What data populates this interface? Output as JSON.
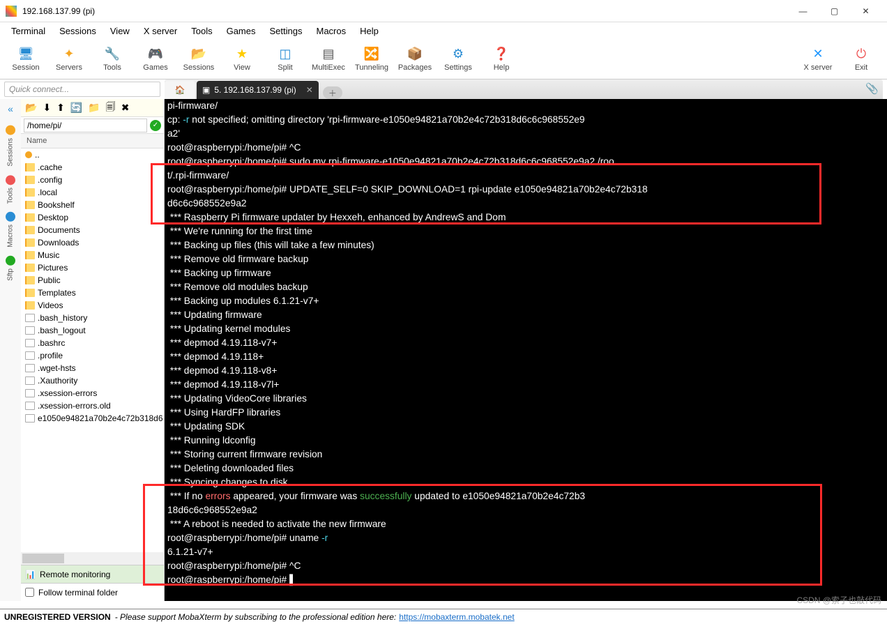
{
  "window": {
    "title": "192.168.137.99 (pi)"
  },
  "menu": [
    "Terminal",
    "Sessions",
    "View",
    "X server",
    "Tools",
    "Games",
    "Settings",
    "Macros",
    "Help"
  ],
  "toolbar": [
    {
      "label": "Session",
      "icon": "🖥",
      "cls": "ic-sess"
    },
    {
      "label": "Servers",
      "icon": "✦",
      "cls": "ic-serv"
    },
    {
      "label": "Tools",
      "icon": "🔧",
      "cls": "ic-tool"
    },
    {
      "label": "Games",
      "icon": "🎮",
      "cls": "ic-game"
    },
    {
      "label": "Sessions",
      "icon": "📂",
      "cls": "ic-sessn"
    },
    {
      "label": "View",
      "icon": "★",
      "cls": "ic-view"
    },
    {
      "label": "Split",
      "icon": "◫",
      "cls": "ic-split"
    },
    {
      "label": "MultiExec",
      "icon": "▤",
      "cls": "ic-multi"
    },
    {
      "label": "Tunneling",
      "icon": "🔀",
      "cls": "ic-tun"
    },
    {
      "label": "Packages",
      "icon": "📦",
      "cls": "ic-pkg"
    },
    {
      "label": "Settings",
      "icon": "⚙",
      "cls": "ic-set"
    },
    {
      "label": "Help",
      "icon": "❓",
      "cls": "ic-help"
    }
  ],
  "toolbar_right": [
    {
      "label": "X server",
      "icon": "✕",
      "cls": "ic-xs"
    },
    {
      "label": "Exit",
      "icon": "⏻",
      "cls": "ic-exit"
    }
  ],
  "quickconnect": {
    "placeholder": "Quick connect..."
  },
  "tabs": [
    {
      "label": "",
      "icon": "🏠",
      "type": "home"
    },
    {
      "label": "5. 192.168.137.99 (pi)",
      "icon": "▣",
      "type": "active",
      "closable": true
    },
    {
      "label": "",
      "icon": "＋",
      "type": "new"
    }
  ],
  "rail": [
    {
      "label": "Sessions",
      "color": "#f5a623"
    },
    {
      "label": "Tools",
      "color": "#e55"
    },
    {
      "label": "Macros",
      "color": "#2a8dd4"
    },
    {
      "label": "Sftp",
      "color": "#2a2"
    }
  ],
  "sftp": {
    "toolbar_icons": [
      "📂",
      "⬇",
      "⬆",
      "🔄",
      "📁",
      "🗐",
      "✖"
    ],
    "path": "/home/pi/",
    "header": "Name",
    "items": [
      {
        "name": "..",
        "type": "dot"
      },
      {
        "name": ".cache",
        "type": "folder"
      },
      {
        "name": ".config",
        "type": "folder"
      },
      {
        "name": ".local",
        "type": "folder"
      },
      {
        "name": "Bookshelf",
        "type": "folder"
      },
      {
        "name": "Desktop",
        "type": "folder"
      },
      {
        "name": "Documents",
        "type": "folder"
      },
      {
        "name": "Downloads",
        "type": "folder"
      },
      {
        "name": "Music",
        "type": "folder"
      },
      {
        "name": "Pictures",
        "type": "folder"
      },
      {
        "name": "Public",
        "type": "folder"
      },
      {
        "name": "Templates",
        "type": "folder"
      },
      {
        "name": "Videos",
        "type": "folder"
      },
      {
        "name": ".bash_history",
        "type": "file"
      },
      {
        "name": ".bash_logout",
        "type": "file"
      },
      {
        "name": ".bashrc",
        "type": "file"
      },
      {
        "name": ".profile",
        "type": "file"
      },
      {
        "name": ".wget-hsts",
        "type": "file"
      },
      {
        "name": ".Xauthority",
        "type": "file"
      },
      {
        "name": ".xsession-errors",
        "type": "file"
      },
      {
        "name": ".xsession-errors.old",
        "type": "file"
      },
      {
        "name": "e1050e94821a70b2e4c72b318d6",
        "type": "file"
      }
    ],
    "remote_monitoring": "Remote monitoring",
    "follow": "Follow terminal folder"
  },
  "terminal": {
    "lines": [
      [
        {
          "t": "pi-firmware/"
        }
      ],
      [
        {
          "t": "cp: "
        },
        {
          "t": "-r",
          "c": "cy"
        },
        {
          "t": " not specified; omitting directory 'rpi-firmware-e1050e94821a70b2e4c72b318d6c6c968552e9"
        }
      ],
      [
        {
          "t": "a2'"
        }
      ],
      [
        {
          "t": "root@raspberrypi:/home/pi# ^C"
        }
      ],
      [
        {
          "t": "root@raspberrypi:/home/pi# sudo mv rpi-firmware-e1050e94821a70b2e4c72b318d6c6c968552e9a2 /roo"
        }
      ],
      [
        {
          "t": "t/.rpi-firmware/"
        }
      ],
      [
        {
          "t": "root@raspberrypi:/home/pi# UPDATE_SELF=0 SKIP_DOWNLOAD=1 rpi-update e1050e94821a70b2e4c72b318"
        }
      ],
      [
        {
          "t": "d6c6c968552e9a2"
        }
      ],
      [
        {
          "t": " *** Raspberry Pi firmware updater by Hexxeh, enhanced by AndrewS and Dom"
        }
      ],
      [
        {
          "t": " *** We're running for the first time"
        }
      ],
      [
        {
          "t": " *** Backing up files (this will take a few minutes)"
        }
      ],
      [
        {
          "t": " *** Remove old firmware backup"
        }
      ],
      [
        {
          "t": " *** Backing up firmware"
        }
      ],
      [
        {
          "t": " *** Remove old modules backup"
        }
      ],
      [
        {
          "t": " *** Backing up modules 6.1.21-v7+"
        }
      ],
      [
        {
          "t": " *** Updating firmware"
        }
      ],
      [
        {
          "t": " *** Updating kernel modules"
        }
      ],
      [
        {
          "t": " *** depmod 4.19.118-v7+"
        }
      ],
      [
        {
          "t": " *** depmod 4.19.118+"
        }
      ],
      [
        {
          "t": " *** depmod 4.19.118-v8+"
        }
      ],
      [
        {
          "t": " *** depmod 4.19.118-v7l+"
        }
      ],
      [
        {
          "t": " *** Updating VideoCore libraries"
        }
      ],
      [
        {
          "t": " *** Using HardFP libraries"
        }
      ],
      [
        {
          "t": " *** Updating SDK"
        }
      ],
      [
        {
          "t": " *** Running ldconfig"
        }
      ],
      [
        {
          "t": " *** Storing current firmware revision"
        }
      ],
      [
        {
          "t": " *** Deleting downloaded files"
        }
      ],
      [
        {
          "t": " *** Syncing changes to disk"
        }
      ],
      [
        {
          "t": " *** If no "
        },
        {
          "t": "errors",
          "c": "rd"
        },
        {
          "t": " appeared, your firmware was "
        },
        {
          "t": "successfully",
          "c": "gr"
        },
        {
          "t": " updated to e1050e94821a70b2e4c72b3"
        }
      ],
      [
        {
          "t": "18d6c6c968552e9a2"
        }
      ],
      [
        {
          "t": " *** A reboot is needed to activate the new firmware"
        }
      ],
      [
        {
          "t": "root@raspberrypi:/home/pi# uname "
        },
        {
          "t": "-r",
          "c": "cy"
        }
      ],
      [
        {
          "t": "6.1.21-v7+"
        }
      ],
      [
        {
          "t": "root@raspberrypi:/home/pi# ^C"
        }
      ],
      [
        {
          "t": "root@raspberrypi:/home/pi# "
        },
        {
          "t": "▌"
        }
      ]
    ]
  },
  "status": {
    "prefix": "UNREGISTERED VERSION",
    "text": " -  Please support MobaXterm by subscribing to the professional edition here:  ",
    "link": "https://mobaxterm.mobatek.net"
  },
  "watermark": "CSDN @索子也敲代码"
}
